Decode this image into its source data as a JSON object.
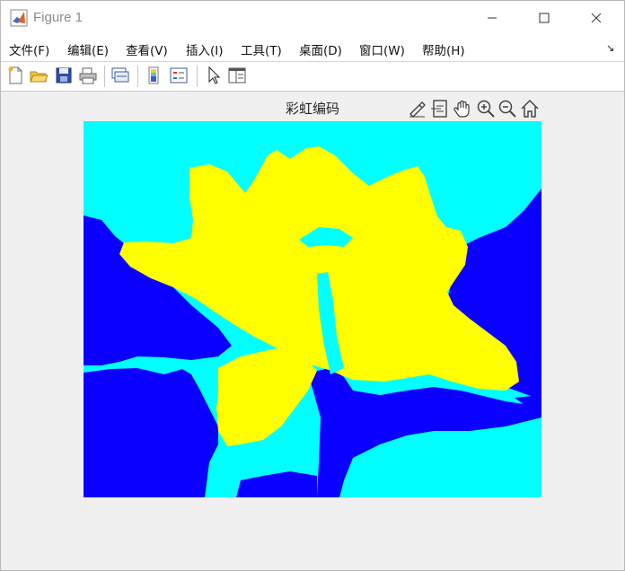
{
  "window": {
    "title": "Figure 1",
    "controls": [
      "minimize",
      "maximize",
      "close"
    ]
  },
  "menu": {
    "items": [
      "文件(F)",
      "编辑(E)",
      "查看(V)",
      "插入(I)",
      "工具(T)",
      "桌面(D)",
      "窗口(W)",
      "帮助(H)"
    ]
  },
  "toolbar": {
    "icons": [
      "new-figure-icon",
      "open-file-icon",
      "save-icon",
      "print-icon",
      "link-plot-icon",
      "colorbar-icon",
      "legend-icon",
      "select-arrow-icon",
      "property-inspector-icon"
    ]
  },
  "axes": {
    "title": "彩虹编码",
    "toolbar_icons": [
      "brush-icon",
      "data-tips-icon",
      "pan-hand-icon",
      "zoom-in-icon",
      "zoom-out-icon",
      "home-icon"
    ]
  },
  "image": {
    "description_colors": {
      "background_dark": "#0a00ff",
      "background_light": "#00ffff",
      "flower": "#ffff00"
    }
  }
}
